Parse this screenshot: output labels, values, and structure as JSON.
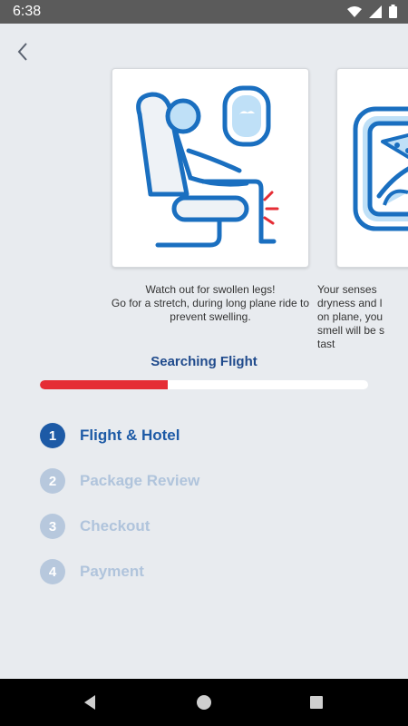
{
  "status_bar": {
    "time": "6:38",
    "icons": [
      "wifi-icon",
      "signal-icon",
      "battery-icon"
    ]
  },
  "header": {
    "back_icon": "chevron-left-icon"
  },
  "carousel": {
    "cards": [
      {
        "illustration": "airplane-seat-swollen-legs-illustration",
        "text": "Watch out for swollen legs!\nGo for a stretch, during long plane ride to\nprevent swelling."
      },
      {
        "illustration": "airplane-meal-tray-illustration",
        "text": "Your senses\ndryness and l\non plane, you\nsmell will be s\ntast"
      }
    ]
  },
  "search": {
    "title": "Searching Flight",
    "progress": 0.39,
    "progress_color": "#e52d35"
  },
  "steps": [
    {
      "number": "1",
      "label": "Flight & Hotel",
      "state": "active"
    },
    {
      "number": "2",
      "label": "Package Review",
      "state": "inactive"
    },
    {
      "number": "3",
      "label": "Checkout",
      "state": "inactive"
    },
    {
      "number": "4",
      "label": "Payment",
      "state": "inactive"
    }
  ],
  "colors": {
    "accent": "#1d5aa6",
    "inactive": "#b7c8dd",
    "background": "#e8ebef"
  },
  "nav_bar": {
    "buttons": [
      "back-triangle-icon",
      "home-circle-icon",
      "recents-square-icon"
    ]
  }
}
